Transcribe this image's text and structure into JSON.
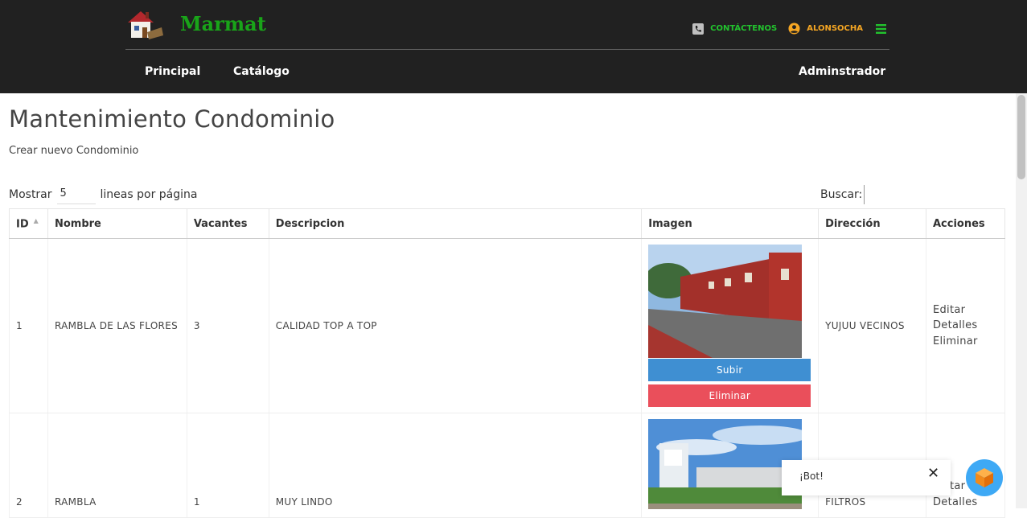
{
  "header": {
    "brand": "Marmat",
    "contact_label": "CONTÁCTENOS",
    "user_label": "ALONSOCHA",
    "nav": [
      {
        "label": "Principal"
      },
      {
        "label": "Catálogo"
      },
      {
        "label": "Adminstrador"
      }
    ],
    "colors": {
      "bar": "#212121",
      "brand": "#19a419",
      "contact": "#22c32e",
      "user": "#f5a623"
    }
  },
  "main": {
    "title": "Mantenimiento Condominio",
    "create_link": "Crear nuevo Condominio",
    "show_label": "Mostrar",
    "show_value": "5",
    "per_page_label": "lineas por página",
    "search_label": "Buscar:"
  },
  "table": {
    "columns": [
      "ID",
      "Nombre",
      "Vacantes",
      "Descripcion",
      "Imagen",
      "Dirección",
      "Acciones"
    ],
    "rows": [
      {
        "id": "1",
        "nombre": "RAMBLA DE LAS FLORES",
        "vacantes": "3",
        "descripcion": "CALIDAD TOP A TOP",
        "direccion": "YUJUU VECINOS",
        "actions": [
          "Editar",
          "Detalles",
          "Eliminar"
        ],
        "upload_label": "Subir",
        "delete_label": "Eliminar"
      },
      {
        "id": "2",
        "nombre": "RAMBLA",
        "vacantes": "1",
        "descripcion": "MUY LINDO",
        "direccion": "FILTROS",
        "actions": [
          "Editar",
          "Detalles"
        ]
      }
    ]
  },
  "chat": {
    "text": "¡Bot!"
  }
}
